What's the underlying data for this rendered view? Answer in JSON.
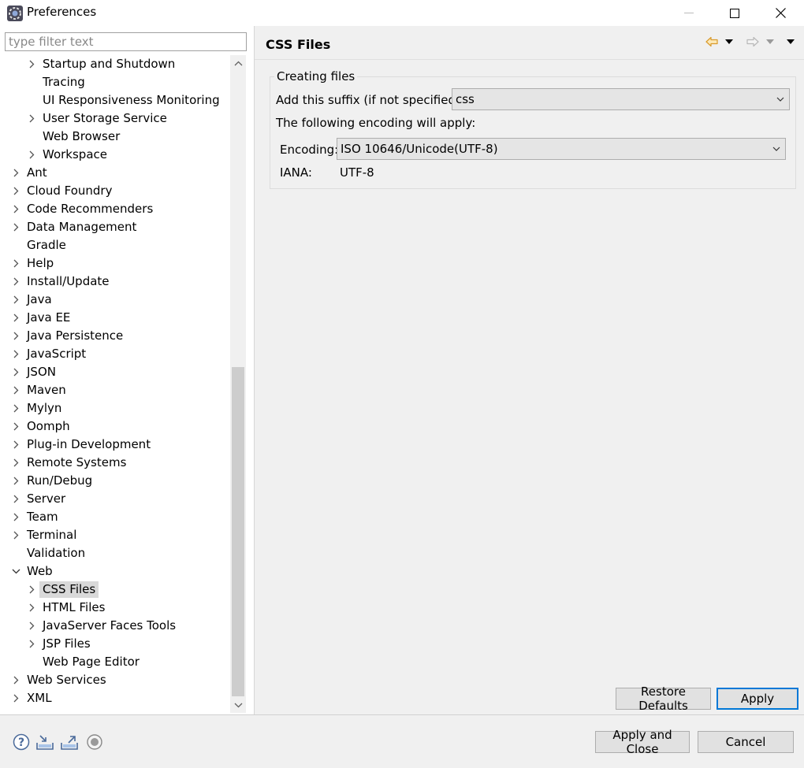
{
  "window": {
    "title": "Preferences"
  },
  "filter": {
    "placeholder": "type filter text",
    "value": ""
  },
  "tree": [
    {
      "label": "Startup and Shutdown",
      "expander": "collapsed"
    },
    {
      "label": "Tracing",
      "expander": "none"
    },
    {
      "label": "UI Responsiveness Monitoring",
      "expander": "none"
    },
    {
      "label": "User Storage Service",
      "expander": "collapsed"
    },
    {
      "label": "Web Browser",
      "expander": "none"
    },
    {
      "label": "Workspace",
      "expander": "collapsed"
    },
    {
      "label": "Ant",
      "expander": "collapsed"
    },
    {
      "label": "Cloud Foundry",
      "expander": "collapsed"
    },
    {
      "label": "Code Recommenders",
      "expander": "collapsed"
    },
    {
      "label": "Data Management",
      "expander": "collapsed"
    },
    {
      "label": "Gradle",
      "expander": "none"
    },
    {
      "label": "Help",
      "expander": "collapsed"
    },
    {
      "label": "Install/Update",
      "expander": "collapsed"
    },
    {
      "label": "Java",
      "expander": "collapsed"
    },
    {
      "label": "Java EE",
      "expander": "collapsed"
    },
    {
      "label": "Java Persistence",
      "expander": "collapsed"
    },
    {
      "label": "JavaScript",
      "expander": "collapsed"
    },
    {
      "label": "JSON",
      "expander": "collapsed"
    },
    {
      "label": "Maven",
      "expander": "collapsed"
    },
    {
      "label": "Mylyn",
      "expander": "collapsed"
    },
    {
      "label": "Oomph",
      "expander": "collapsed"
    },
    {
      "label": "Plug-in Development",
      "expander": "collapsed"
    },
    {
      "label": "Remote Systems",
      "expander": "collapsed"
    },
    {
      "label": "Run/Debug",
      "expander": "collapsed"
    },
    {
      "label": "Server",
      "expander": "collapsed"
    },
    {
      "label": "Team",
      "expander": "collapsed"
    },
    {
      "label": "Terminal",
      "expander": "collapsed"
    },
    {
      "label": "Validation",
      "expander": "none"
    },
    {
      "label": "Web",
      "expander": "expanded"
    },
    {
      "label": "CSS Files",
      "expander": "collapsed",
      "selected": true
    },
    {
      "label": "HTML Files",
      "expander": "collapsed"
    },
    {
      "label": "JavaServer Faces Tools",
      "expander": "collapsed"
    },
    {
      "label": "JSP Files",
      "expander": "collapsed"
    },
    {
      "label": "Web Page Editor",
      "expander": "none"
    },
    {
      "label": "Web Services",
      "expander": "collapsed"
    },
    {
      "label": "XML",
      "expander": "collapsed"
    }
  ],
  "page": {
    "title": "CSS Files",
    "group_title": "Creating files",
    "suffix_label": "Add this suffix (if not specified):",
    "suffix_value": "css",
    "encoding_note": "The following encoding will apply:",
    "encoding_label": "Encoding:",
    "encoding_value": "ISO 10646/Unicode(UTF-8)",
    "iana_label": "IANA:",
    "iana_value": "UTF-8",
    "restore_defaults": "Restore Defaults",
    "apply": "Apply"
  },
  "dialog": {
    "apply_and_close": "Apply and Close",
    "cancel": "Cancel"
  },
  "colors": {
    "nav_back": "#e8a33d",
    "selection": "#d9d9d9",
    "default_button_border": "#0078d7"
  }
}
